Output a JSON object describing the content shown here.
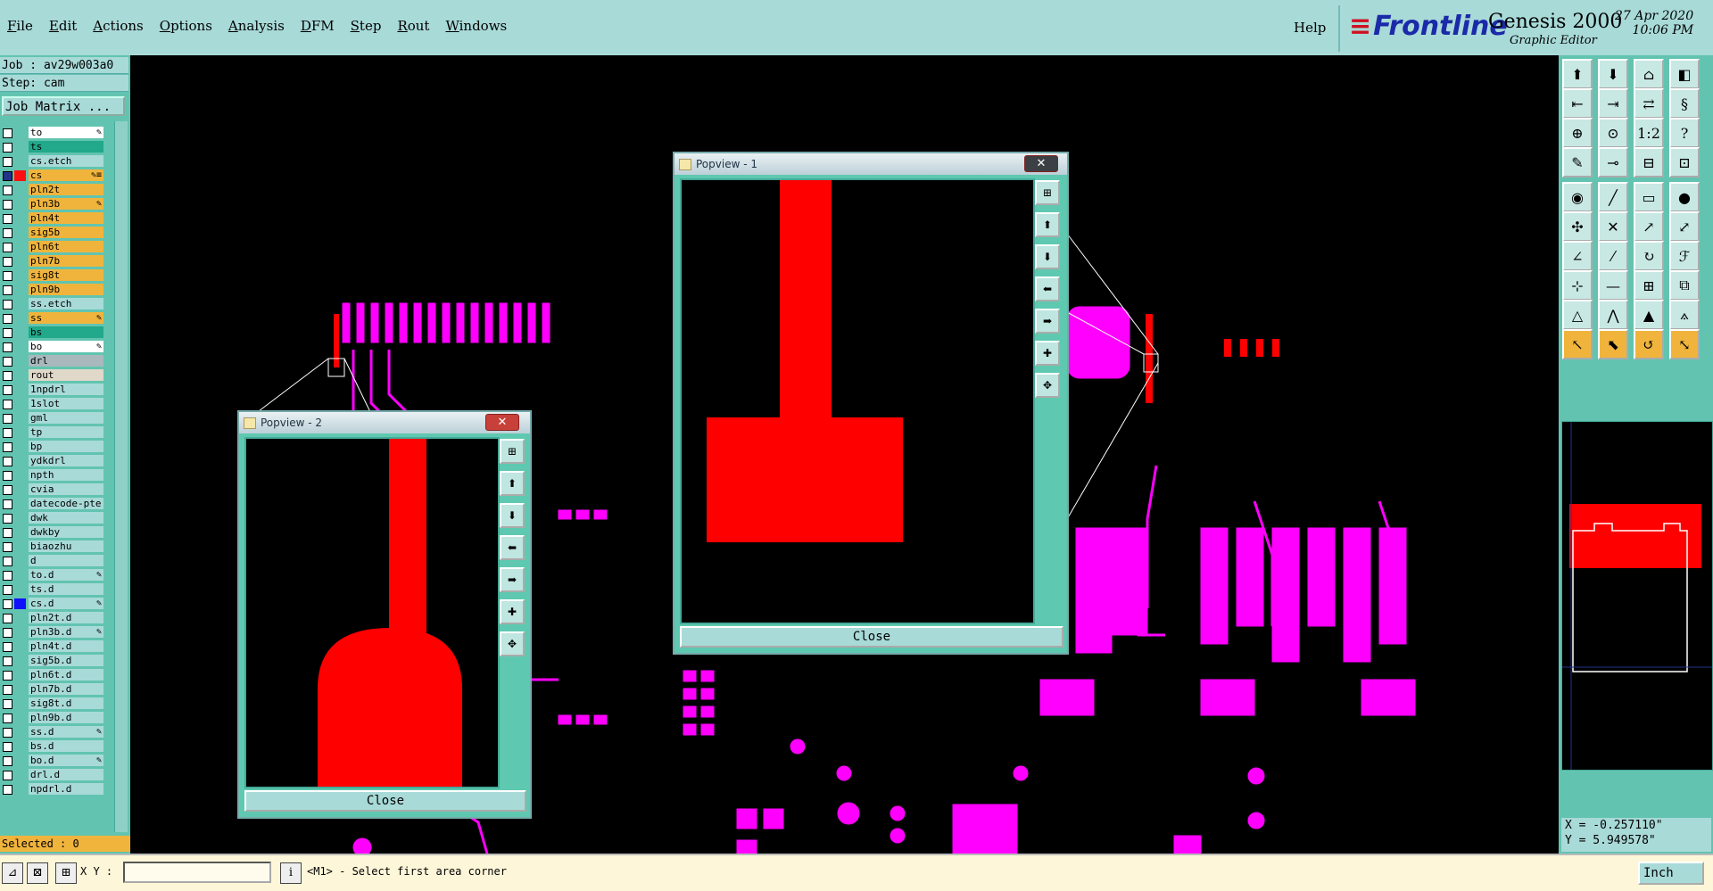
{
  "menu": [
    "File",
    "Edit",
    "Actions",
    "Options",
    "Analysis",
    "DFM",
    "Step",
    "Rout",
    "Windows"
  ],
  "help_label": "Help",
  "brand": {
    "company": "Frontline",
    "product": "Genesis 2000",
    "subtitle": "Graphic Editor",
    "date": "27 Apr 2020",
    "time": "10:06 PM"
  },
  "job": {
    "job_line": "Job : av29w003a0",
    "step_line": "Step: cam",
    "matrix_button": "Job Matrix ...",
    "selected": "Selected : 0"
  },
  "layers": [
    {
      "name": "to",
      "bg": "#ffffff",
      "mark": "✎"
    },
    {
      "name": "ts",
      "bg": "#22a88a",
      "mark": ""
    },
    {
      "name": "cs.etch",
      "bg": "#a8dad8",
      "mark": ""
    },
    {
      "name": "cs",
      "bg": "#f0b43c",
      "mark": "✎≡",
      "color": "#ff1010",
      "checked": true
    },
    {
      "name": "pln2t",
      "bg": "#f0b43c",
      "mark": ""
    },
    {
      "name": "pln3b",
      "bg": "#f0b43c",
      "mark": "✎"
    },
    {
      "name": "pln4t",
      "bg": "#f0b43c",
      "mark": ""
    },
    {
      "name": "sig5b",
      "bg": "#f0b43c",
      "mark": ""
    },
    {
      "name": "pln6t",
      "bg": "#f0b43c",
      "mark": ""
    },
    {
      "name": "pln7b",
      "bg": "#f0b43c",
      "mark": ""
    },
    {
      "name": "sig8t",
      "bg": "#f0b43c",
      "mark": ""
    },
    {
      "name": "pln9b",
      "bg": "#f0b43c",
      "mark": ""
    },
    {
      "name": "ss.etch",
      "bg": "#a8dad8",
      "mark": ""
    },
    {
      "name": "ss",
      "bg": "#f0b43c",
      "mark": "✎"
    },
    {
      "name": "bs",
      "bg": "#22a88a",
      "mark": ""
    },
    {
      "name": "bo",
      "bg": "#ffffff",
      "mark": "✎"
    },
    {
      "name": "drl",
      "bg": "#a8b8bc",
      "mark": ""
    },
    {
      "name": "rout",
      "bg": "#e0d8c8",
      "mark": ""
    },
    {
      "name": "1npdrl",
      "bg": "#a8dad8",
      "mark": ""
    },
    {
      "name": "1slot",
      "bg": "#a8dad8",
      "mark": ""
    },
    {
      "name": "gml",
      "bg": "#a8dad8",
      "mark": ""
    },
    {
      "name": "tp",
      "bg": "#a8dad8",
      "mark": ""
    },
    {
      "name": "bp",
      "bg": "#a8dad8",
      "mark": ""
    },
    {
      "name": "ydkdrl",
      "bg": "#a8dad8",
      "mark": ""
    },
    {
      "name": "npth",
      "bg": "#a8dad8",
      "mark": ""
    },
    {
      "name": "cvia",
      "bg": "#a8dad8",
      "mark": ""
    },
    {
      "name": "datecode-pte",
      "bg": "#a8dad8",
      "mark": ""
    },
    {
      "name": "dwk",
      "bg": "#a8dad8",
      "mark": ""
    },
    {
      "name": "dwkby",
      "bg": "#a8dad8",
      "mark": ""
    },
    {
      "name": "biaozhu",
      "bg": "#a8dad8",
      "mark": ""
    },
    {
      "name": "d",
      "bg": "#a8dad8",
      "mark": ""
    },
    {
      "name": "to.d",
      "bg": "#a8dad8",
      "mark": "✎"
    },
    {
      "name": "ts.d",
      "bg": "#a8dad8",
      "mark": ""
    },
    {
      "name": "cs.d",
      "bg": "#a8dad8",
      "mark": "✎",
      "color": "#1010ff"
    },
    {
      "name": "pln2t.d",
      "bg": "#a8dad8",
      "mark": ""
    },
    {
      "name": "pln3b.d",
      "bg": "#a8dad8",
      "mark": "✎"
    },
    {
      "name": "pln4t.d",
      "bg": "#a8dad8",
      "mark": ""
    },
    {
      "name": "sig5b.d",
      "bg": "#a8dad8",
      "mark": ""
    },
    {
      "name": "pln6t.d",
      "bg": "#a8dad8",
      "mark": ""
    },
    {
      "name": "pln7b.d",
      "bg": "#a8dad8",
      "mark": ""
    },
    {
      "name": "sig8t.d",
      "bg": "#a8dad8",
      "mark": ""
    },
    {
      "name": "pln9b.d",
      "bg": "#a8dad8",
      "mark": ""
    },
    {
      "name": "ss.d",
      "bg": "#a8dad8",
      "mark": "✎"
    },
    {
      "name": "bs.d",
      "bg": "#a8dad8",
      "mark": ""
    },
    {
      "name": "bo.d",
      "bg": "#a8dad8",
      "mark": "✎"
    },
    {
      "name": "drl.d",
      "bg": "#a8dad8",
      "mark": ""
    },
    {
      "name": "npdrl.d",
      "bg": "#a8dad8",
      "mark": ""
    }
  ],
  "popview1": {
    "title": "Popview - 1",
    "close_label": "Close"
  },
  "popview2": {
    "title": "Popview - 2",
    "close_label": "Close"
  },
  "coords": {
    "x": "X = -0.257110\"",
    "y": "Y = 5.949578\""
  },
  "bottom": {
    "xy_label": "X Y :",
    "status": "<M1> - Select first area corner",
    "units": "Inch"
  },
  "colors": {
    "panel": "#62c4b0",
    "menu": "#a8dad8",
    "copper": "#ff0000",
    "soldermask": "#ff00ff",
    "selected": "#f0b43c"
  }
}
